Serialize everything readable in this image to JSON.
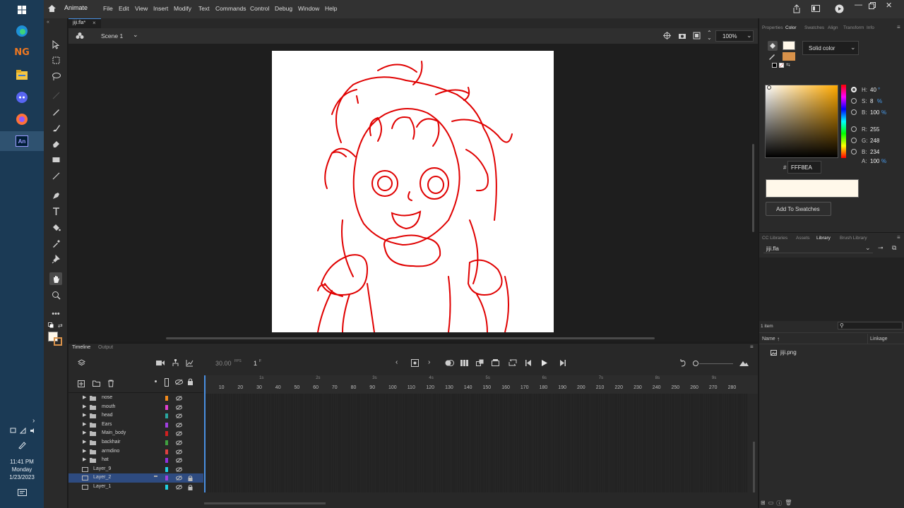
{
  "taskbar": {
    "icons": [
      "windows-start-icon",
      "edge-icon",
      "newgrounds-icon",
      "file-explorer-icon",
      "discord-icon",
      "firefox-icon",
      "animate-icon"
    ],
    "ng_label": "NG",
    "animate_label": "An",
    "clock": {
      "time": "11:41 PM",
      "day": "Monday",
      "date": "1/23/2023"
    }
  },
  "menubar": {
    "app": "Animate",
    "items": [
      "File",
      "Edit",
      "View",
      "Insert",
      "Modify",
      "Text",
      "Commands",
      "Control",
      "Debug",
      "Window",
      "Help"
    ]
  },
  "document": {
    "tab": "jiji.fla*",
    "scene": "Scene 1",
    "zoom": "100%"
  },
  "panel": {
    "tabs": [
      "Properties",
      "Color",
      "Swatches",
      "Align",
      "Transform",
      "Info"
    ],
    "active_tab": "Color",
    "fill_type": "Solid color",
    "hsb": {
      "h_label": "H:",
      "h": "40",
      "h_unit": "°",
      "s_label": "S:",
      "s": "8",
      "s_unit": "%",
      "b_label": "B:",
      "b": "100",
      "b_unit": "%"
    },
    "rgb": {
      "r_label": "R:",
      "r": "255",
      "g_label": "G:",
      "g": "248",
      "b_label": "B:",
      "b": "234",
      "a_label": "A:",
      "a": "100",
      "a_unit": "%"
    },
    "hex_label": "#",
    "hex": "FFF8EA",
    "add_swatches": "Add To Swatches",
    "stroke_color": "#fff8ea",
    "fill_color": "#d9924a"
  },
  "library": {
    "tabs": [
      "CC Libraries",
      "Assets",
      "Library",
      "Brush Library"
    ],
    "active_tab": "Library",
    "file": "jiji.fla",
    "count": "1 item",
    "col_name": "Name",
    "col_linkage": "Linkage",
    "items": [
      "jiji.png"
    ]
  },
  "timeline": {
    "tabs": [
      "Timeline",
      "Output"
    ],
    "fps": "30.00",
    "fps_unit": "FPS",
    "frame": "1",
    "frame_unit": "F",
    "seconds": [
      "1s",
      "2s",
      "3s",
      "4s",
      "5s",
      "6s",
      "7s",
      "8s",
      "9s"
    ],
    "frame_ticks": [
      "10",
      "20",
      "30",
      "40",
      "50",
      "60",
      "70",
      "80",
      "90",
      "100",
      "110",
      "120",
      "130",
      "140",
      "150",
      "160",
      "170",
      "180",
      "190",
      "200",
      "210",
      "220",
      "230",
      "240",
      "250",
      "260",
      "270",
      "280"
    ],
    "layers": [
      {
        "name": "nose",
        "folder": true,
        "color": "#f28b1c"
      },
      {
        "name": "mouth",
        "folder": true,
        "color": "#e040d0"
      },
      {
        "name": "head",
        "folder": true,
        "color": "#2aa7a0"
      },
      {
        "name": "Ears",
        "folder": true,
        "color": "#a040e0"
      },
      {
        "name": "Main_body",
        "folder": true,
        "color": "#d02020"
      },
      {
        "name": "backhair",
        "folder": true,
        "color": "#40a040"
      },
      {
        "name": "armdino",
        "folder": true,
        "color": "#e04040"
      },
      {
        "name": "hat",
        "folder": true,
        "color": "#9030e0"
      },
      {
        "name": "Layer_9",
        "folder": false,
        "color": "#20d0e0"
      },
      {
        "name": "Layer_2",
        "folder": false,
        "color": "#a040e0",
        "selected": true,
        "locked": true
      },
      {
        "name": "Layer_1",
        "folder": false,
        "color": "#20d0e0",
        "locked": true
      }
    ]
  }
}
